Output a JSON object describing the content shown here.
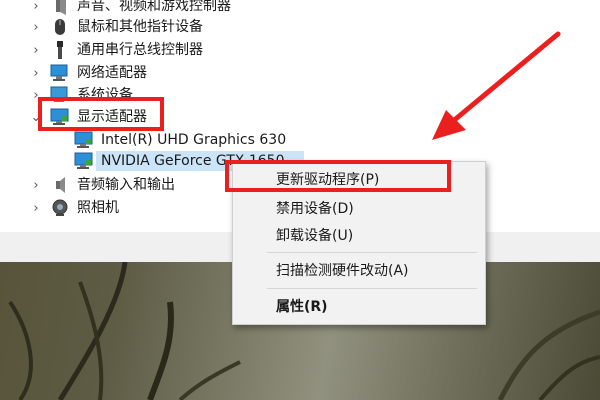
{
  "device_tree": {
    "items": [
      {
        "label": "声音、视频和游戏控制器",
        "icon": "speaker-icon"
      },
      {
        "label": "鼠标和其他指针设备",
        "icon": "mouse-icon"
      },
      {
        "label": "通用串行总线控制器",
        "icon": "usb-icon"
      },
      {
        "label": "网络适配器",
        "icon": "network-icon"
      },
      {
        "label": "系统设备",
        "icon": "system-device-icon"
      },
      {
        "label": "显示适配器",
        "icon": "display-adapter-icon"
      },
      {
        "label": "Intel(R) UHD Graphics 630",
        "icon": "monitor-icon"
      },
      {
        "label": "NVIDIA GeForce GTX 1650",
        "icon": "monitor-icon"
      },
      {
        "label": "音频输入和输出",
        "icon": "audio-icon"
      },
      {
        "label": "照相机",
        "icon": "camera-icon"
      }
    ]
  },
  "context_menu": {
    "update_driver": "更新驱动程序(P)",
    "disable_device": "禁用设备(D)",
    "uninstall_device": "卸载设备(U)",
    "scan_hardware": "扫描检测硬件改动(A)",
    "properties": "属性(R)"
  },
  "colors": {
    "highlight_red": "#ec1f1f",
    "selection_blue": "#cce4f7",
    "menu_bg": "#f2f2f2"
  }
}
